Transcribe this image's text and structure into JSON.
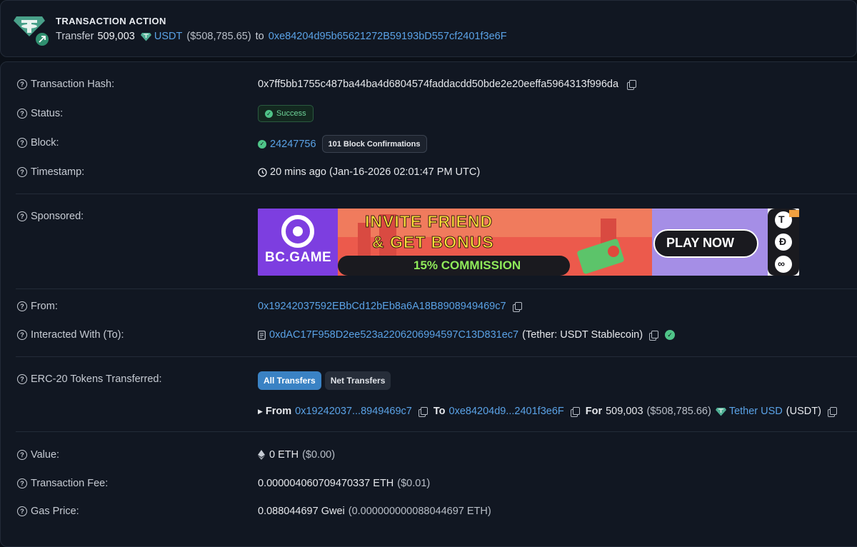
{
  "action": {
    "title": "TRANSACTION ACTION",
    "prefix": "Transfer",
    "amount": "509,003",
    "token": "USDT",
    "usd": "($508,785.65)",
    "to_word": "to",
    "to_address": "0xe84204d95b65621272B59193bD557cf2401f3e6F"
  },
  "rows": {
    "hash": {
      "label": "Transaction Hash:",
      "value": "0x7ff5bb1755c487ba44ba4d6804574faddacdd50bde2e20eeffa5964313f996da"
    },
    "status": {
      "label": "Status:",
      "value": "Success"
    },
    "block": {
      "label": "Block:",
      "value": "24247756",
      "confirmations": "101 Block Confirmations"
    },
    "timestamp": {
      "label": "Timestamp:",
      "value": "20 mins ago (Jan-16-2026 02:01:47 PM UTC)"
    },
    "sponsored": {
      "label": "Sponsored:"
    },
    "from": {
      "label": "From:",
      "value": "0x19242037592EBbCd12bEb8a6A18B8908949469c7"
    },
    "interacted": {
      "label": "Interacted With (To):",
      "value": "0xdAC17F958D2ee523a2206206994597C13D831ec7",
      "name": "(Tether: USDT Stablecoin)"
    },
    "erc20": {
      "label": "ERC-20 Tokens Transferred:",
      "tab_all": "All Transfers",
      "tab_net": "Net Transfers",
      "from_word": "From",
      "from_addr": "0x19242037...8949469c7",
      "to_word": "To",
      "to_addr": "0xe84204d9...2401f3e6F",
      "for_word": "For",
      "amount": "509,003",
      "usd": "($508,785.66)",
      "token_name": "Tether USD",
      "token_symbol": "(USDT)"
    },
    "value": {
      "label": "Value:",
      "eth": "0 ETH",
      "usd": "($0.00)"
    },
    "fee": {
      "label": "Transaction Fee:",
      "eth": "0.000004060709470337 ETH",
      "usd": "($0.01)"
    },
    "gas": {
      "label": "Gas Price:",
      "gwei": "0.088044697 Gwei",
      "eth": "(0.000000000088044697 ETH)"
    }
  },
  "ad": {
    "brand": "BC.GAME",
    "headline_1": "INVITE FRIEND",
    "headline_2": "& GET BONUS",
    "commission": "15% COMMISSION",
    "cta": "PLAY NOW"
  },
  "colors": {
    "background": "#0b1018",
    "card": "#111722",
    "link": "#5aa2e6",
    "success": "#4fc488",
    "tether": "#50af95",
    "active_tab": "#3a82c4"
  }
}
